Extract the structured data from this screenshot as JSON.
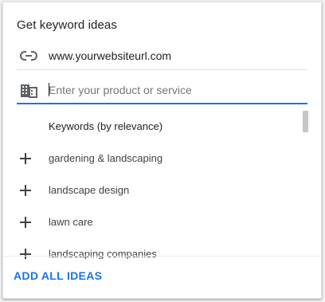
{
  "panel": {
    "title": "Get keyword ideas",
    "website": {
      "icon": "link-icon",
      "value": "www.yourwebsiteurl.com"
    },
    "product_input": {
      "icon": "business-icon",
      "placeholder": "Enter your product or service",
      "value": ""
    },
    "list_header": "Keywords (by relevance)",
    "items": [
      {
        "icon": "plus-icon",
        "label": "gardening & landscaping"
      },
      {
        "icon": "plus-icon",
        "label": "landscape design"
      },
      {
        "icon": "plus-icon",
        "label": "lawn care"
      },
      {
        "icon": "plus-icon",
        "label": "landscaping companies"
      }
    ],
    "add_all_label": "ADD ALL IDEAS"
  },
  "colors": {
    "accent": "#1a73e8",
    "text": "#212121",
    "muted": "#757575",
    "scrollbar": "#c6c6c6"
  }
}
